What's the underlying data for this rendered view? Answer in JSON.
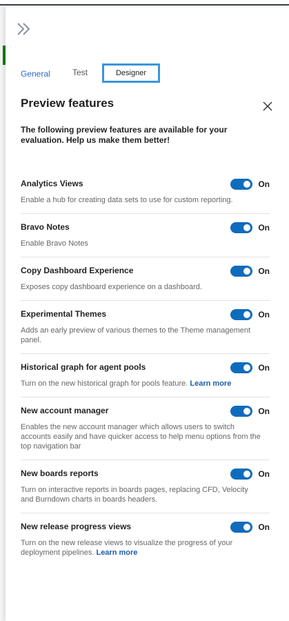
{
  "tabs": {
    "general": "General",
    "test": "Test",
    "designer": "Designer"
  },
  "dialog": {
    "title": "Preview features",
    "intro": "The following preview features are available for your evaluation. Help us make them better!"
  },
  "features": [
    {
      "name": "Analytics Views",
      "desc": "Enable a hub for creating data sets to use for custom reporting.",
      "state": "On",
      "link": ""
    },
    {
      "name": "Bravo Notes",
      "desc": "Enable Bravo Notes",
      "state": "On",
      "link": ""
    },
    {
      "name": "Copy Dashboard Experience",
      "desc": "Exposes copy dashboard experience on a dashboard.",
      "state": "On",
      "link": ""
    },
    {
      "name": "Experimental Themes",
      "desc": "Adds an early preview of various themes to the Theme management panel.",
      "state": "On",
      "link": ""
    },
    {
      "name": "Historical graph for agent pools",
      "desc": "Turn on the new historical graph for pools feature.",
      "state": "On",
      "link": "Learn more"
    },
    {
      "name": "New account manager",
      "desc": "Enables the new account manager which allows users to switch accounts easily and have quicker access to help menu options from the top navigation bar",
      "state": "On",
      "link": ""
    },
    {
      "name": "New boards reports",
      "desc": "Turn on interactive reports in boards pages, replacing CFD, Velocity and Burndown charts in boards headers.",
      "state": "On",
      "link": ""
    },
    {
      "name": "New release progress views",
      "desc": "Turn on the new release views to visualize the progress of your deployment pipelines.",
      "state": "On",
      "link": "Learn more"
    }
  ],
  "colors": {
    "accent": "#0f6cbd",
    "tab_active": "#2a66c4",
    "designer_border": "#3a96dd"
  }
}
